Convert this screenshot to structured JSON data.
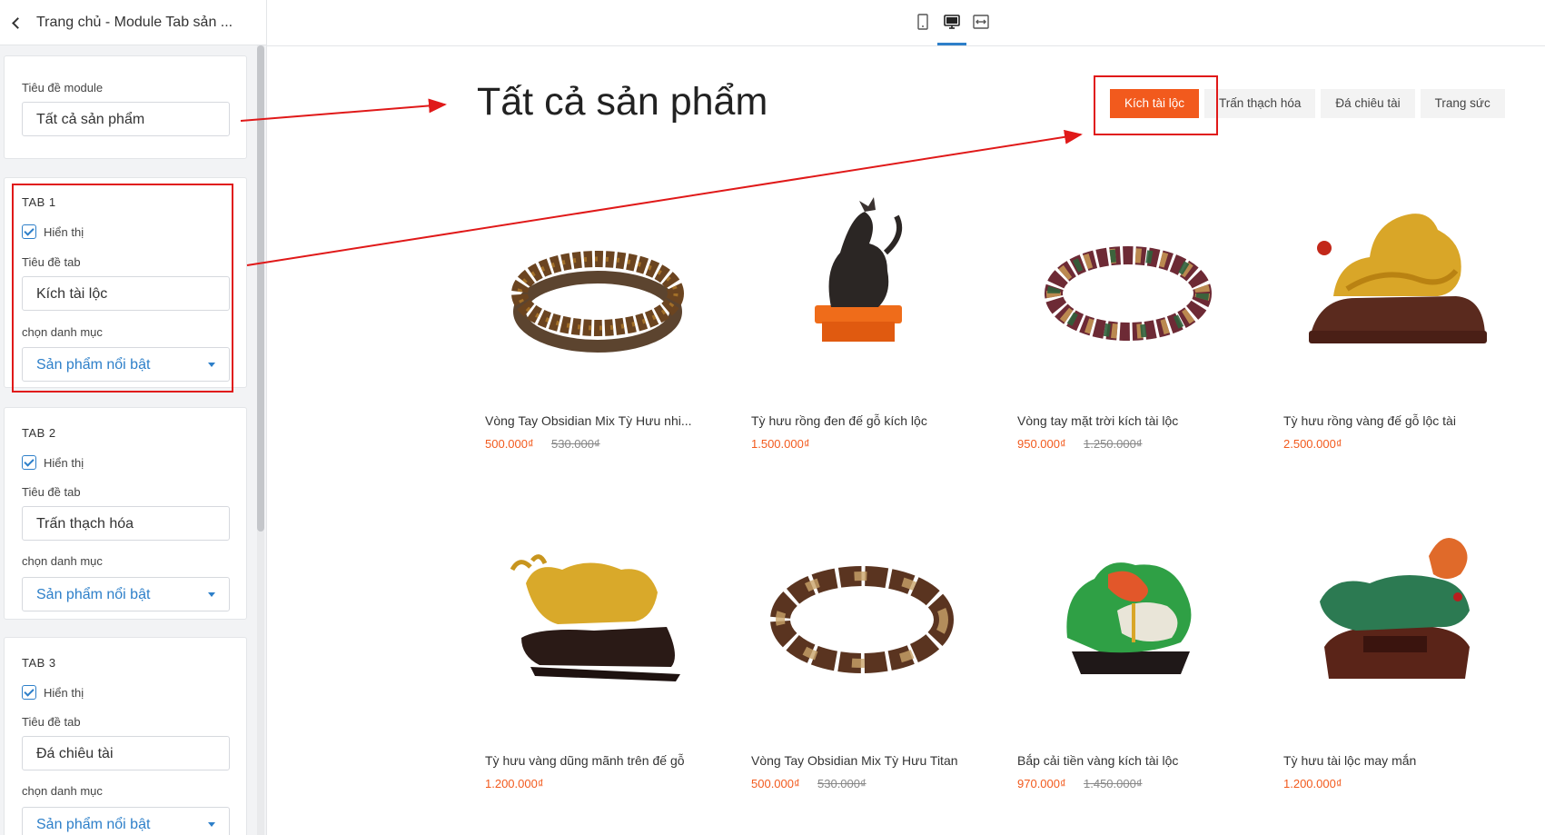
{
  "sidebar": {
    "title": "Trang chủ - Module Tab sản ...",
    "module": {
      "label": "Tiêu đề module",
      "value": "Tất cả sản phẩm"
    },
    "tabs": [
      {
        "heading": "TAB 1",
        "show_label": "Hiển thị",
        "show_checked": true,
        "title_label": "Tiêu đề tab",
        "title_value": "Kích tài lộc",
        "category_label": "chọn danh mục",
        "category_value": "Sản phẩm nổi bật"
      },
      {
        "heading": "TAB 2",
        "show_label": "Hiển thị",
        "show_checked": true,
        "title_label": "Tiêu đề tab",
        "title_value": "Trấn thạch hóa",
        "category_label": "chọn danh mục",
        "category_value": "Sản phẩm nổi bật"
      },
      {
        "heading": "TAB 3",
        "show_label": "Hiển thị",
        "show_checked": true,
        "title_label": "Tiêu đề tab",
        "title_value": "Đá chiêu tài",
        "category_label": "chọn danh mục",
        "category_value": "Sản phẩm nổi bật"
      }
    ]
  },
  "toolbar": {
    "devices": [
      "mobile-icon",
      "desktop-icon",
      "fullwidth-icon"
    ],
    "active_device": "desktop-icon"
  },
  "canvas": {
    "title": "Tất cả sản phẩm",
    "tabs": [
      "Kích tài lộc",
      "Trấn thạch hóa",
      "Đá chiêu tài",
      "Trang sức"
    ],
    "active_tab": "Kích tài lộc",
    "products": [
      {
        "name": "Vòng Tay Obsidian Mix Tỳ Hưu nhi...",
        "price": "500.000₫",
        "old_price": "530.000₫"
      },
      {
        "name": "Tỳ hưu rồng đen đế gỗ kích lộc",
        "price": "1.500.000₫",
        "old_price": ""
      },
      {
        "name": "Vòng tay mặt trời kích tài lộc",
        "price": "950.000₫",
        "old_price": "1.250.000₫"
      },
      {
        "name": "Tỳ hưu rồng vàng đế gỗ lộc tài",
        "price": "2.500.000₫",
        "old_price": ""
      },
      {
        "name": "Tỳ hưu vàng dũng mãnh trên đế gỗ",
        "price": "1.200.000₫",
        "old_price": ""
      },
      {
        "name": "Vòng Tay Obsidian Mix Tỳ Hưu Titan",
        "price": "500.000₫",
        "old_price": "530.000₫"
      },
      {
        "name": "Bắp cải tiền vàng kích tài lộc",
        "price": "970.000₫",
        "old_price": "1.450.000₫"
      },
      {
        "name": "Tỳ hưu tài lộc may mắn",
        "price": "1.200.000₫",
        "old_price": ""
      }
    ]
  },
  "colors": {
    "accent": "#f25a1d",
    "link": "#2d7fc9",
    "annotation": "#e01919"
  }
}
